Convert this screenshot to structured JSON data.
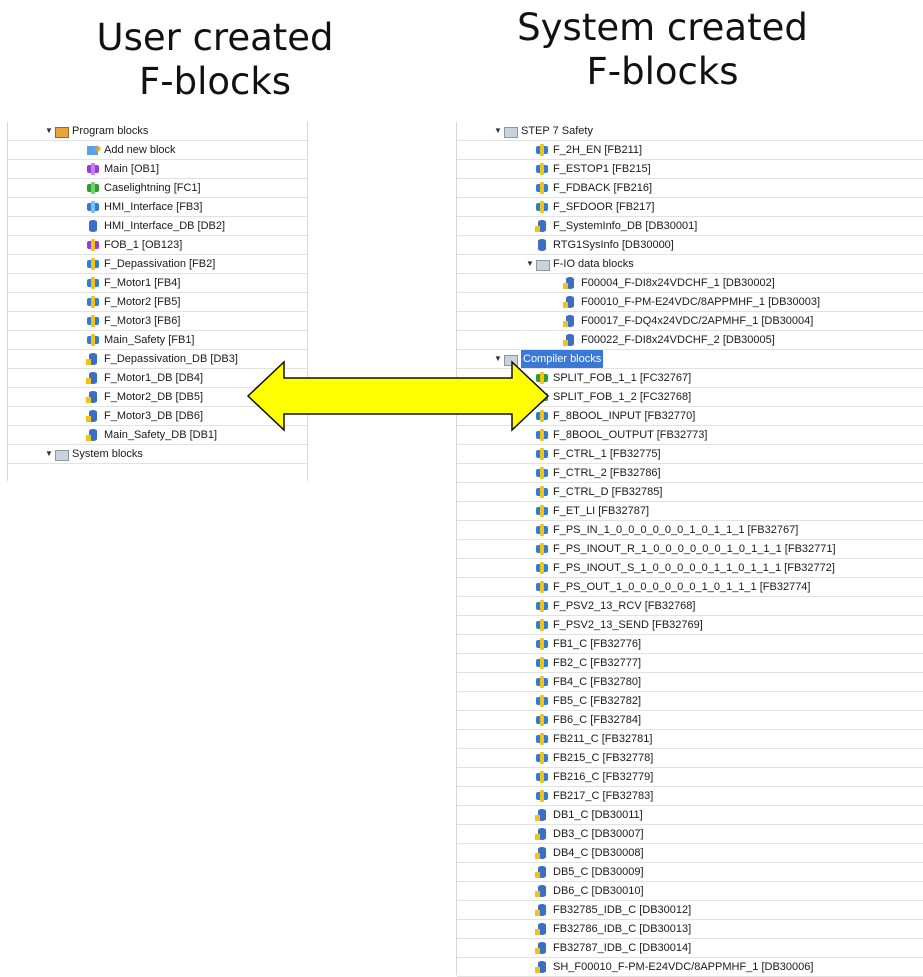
{
  "headings": {
    "left": [
      "User created",
      "F-blocks"
    ],
    "right": [
      "System created",
      "F-blocks"
    ]
  },
  "left_tree": [
    {
      "text": "Program blocks",
      "icon": "folder",
      "indent": 1,
      "toggle": "▼"
    },
    {
      "text": "Add new block",
      "icon": "add",
      "indent": 2
    },
    {
      "text": "Main [OB1]",
      "icon": "ob",
      "indent": 2
    },
    {
      "text": "Caselightning [FC1]",
      "icon": "fc",
      "indent": 2
    },
    {
      "text": "HMI_Interface [FB3]",
      "icon": "fb",
      "indent": 2
    },
    {
      "text": "HMI_Interface_DB [DB2]",
      "icon": "db",
      "indent": 2
    },
    {
      "text": "FOB_1 [OB123]",
      "icon": "fob",
      "indent": 2
    },
    {
      "text": "F_Depassivation [FB2]",
      "icon": "ffb",
      "indent": 2
    },
    {
      "text": "F_Motor1 [FB4]",
      "icon": "ffb",
      "indent": 2
    },
    {
      "text": "F_Motor2 [FB5]",
      "icon": "ffb",
      "indent": 2
    },
    {
      "text": "F_Motor3 [FB6]",
      "icon": "ffb",
      "indent": 2
    },
    {
      "text": "Main_Safety [FB1]",
      "icon": "ffb",
      "indent": 2
    },
    {
      "text": "F_Depassivation_DB [DB3]",
      "icon": "fdb",
      "indent": 2
    },
    {
      "text": "F_Motor1_DB [DB4]",
      "icon": "fdb",
      "indent": 2
    },
    {
      "text": "F_Motor2_DB [DB5]",
      "icon": "fdb",
      "indent": 2
    },
    {
      "text": "F_Motor3_DB [DB6]",
      "icon": "fdb",
      "indent": 2
    },
    {
      "text": "Main_Safety_DB [DB1]",
      "icon": "fdb",
      "indent": 2
    },
    {
      "text": "System blocks",
      "icon": "folder-grey",
      "indent": 1,
      "toggle": "▼"
    }
  ],
  "right_tree": [
    {
      "text": "STEP 7 Safety",
      "icon": "folder-grey",
      "indent": 1,
      "toggle": "▼"
    },
    {
      "text": "F_2H_EN [FB211]",
      "icon": "ffb",
      "indent": 2
    },
    {
      "text": "F_ESTOP1 [FB215]",
      "icon": "ffb",
      "indent": 2
    },
    {
      "text": "F_FDBACK [FB216]",
      "icon": "ffb",
      "indent": 2
    },
    {
      "text": "F_SFDOOR [FB217]",
      "icon": "ffb",
      "indent": 2
    },
    {
      "text": "F_SystemInfo_DB [DB30001]",
      "icon": "fdb",
      "indent": 2
    },
    {
      "text": "RTG1SysInfo [DB30000]",
      "icon": "db",
      "indent": 2
    },
    {
      "text": "F-IO data blocks",
      "icon": "folder-grey",
      "indent": 2,
      "toggle": "▼"
    },
    {
      "text": "F00004_F-DI8x24VDCHF_1 [DB30002]",
      "icon": "fdb",
      "indent": 3
    },
    {
      "text": "F00010_F-PM-E24VDC/8APPMHF_1 [DB30003]",
      "icon": "fdb",
      "indent": 3
    },
    {
      "text": "F00017_F-DQ4x24VDC/2APMHF_1 [DB30004]",
      "icon": "fdb",
      "indent": 3
    },
    {
      "text": "F00022_F-DI8x24VDCHF_2 [DB30005]",
      "icon": "fdb",
      "indent": 3
    },
    {
      "text": "Compiler blocks",
      "icon": "folder-grey",
      "indent": 1,
      "toggle": "▼",
      "selected": true
    },
    {
      "text": "SPLIT_FOB_1_1 [FC32767]",
      "icon": "ffc",
      "indent": 2
    },
    {
      "text": "SPLIT_FOB_1_2 [FC32768]",
      "icon": "ffc",
      "indent": 2
    },
    {
      "text": "F_8BOOL_INPUT [FB32770]",
      "icon": "ffb",
      "indent": 2
    },
    {
      "text": "F_8BOOL_OUTPUT [FB32773]",
      "icon": "ffb",
      "indent": 2
    },
    {
      "text": "F_CTRL_1 [FB32775]",
      "icon": "ffb",
      "indent": 2
    },
    {
      "text": "F_CTRL_2 [FB32786]",
      "icon": "ffb",
      "indent": 2
    },
    {
      "text": "F_CTRL_D [FB32785]",
      "icon": "ffb",
      "indent": 2
    },
    {
      "text": "F_ET_LI [FB32787]",
      "icon": "ffb",
      "indent": 2
    },
    {
      "text": "F_PS_IN_1_0_0_0_0_0_0_1_0_1_1_1 [FB32767]",
      "icon": "ffb",
      "indent": 2
    },
    {
      "text": "F_PS_INOUT_R_1_0_0_0_0_0_0_1_0_1_1_1 [FB32771]",
      "icon": "ffb",
      "indent": 2
    },
    {
      "text": "F_PS_INOUT_S_1_0_0_0_0_0_1_1_0_1_1_1 [FB32772]",
      "icon": "ffb",
      "indent": 2
    },
    {
      "text": "F_PS_OUT_1_0_0_0_0_0_0_1_0_1_1_1 [FB32774]",
      "icon": "ffb",
      "indent": 2
    },
    {
      "text": "F_PSV2_13_RCV [FB32768]",
      "icon": "ffb",
      "indent": 2
    },
    {
      "text": "F_PSV2_13_SEND [FB32769]",
      "icon": "ffb",
      "indent": 2
    },
    {
      "text": "FB1_C [FB32776]",
      "icon": "ffb",
      "indent": 2
    },
    {
      "text": "FB2_C [FB32777]",
      "icon": "ffb",
      "indent": 2
    },
    {
      "text": "FB4_C [FB32780]",
      "icon": "ffb",
      "indent": 2
    },
    {
      "text": "FB5_C [FB32782]",
      "icon": "ffb",
      "indent": 2
    },
    {
      "text": "FB6_C [FB32784]",
      "icon": "ffb",
      "indent": 2
    },
    {
      "text": "FB211_C [FB32781]",
      "icon": "ffb",
      "indent": 2
    },
    {
      "text": "FB215_C [FB32778]",
      "icon": "ffb",
      "indent": 2
    },
    {
      "text": "FB216_C [FB32779]",
      "icon": "ffb",
      "indent": 2
    },
    {
      "text": "FB217_C [FB32783]",
      "icon": "ffb",
      "indent": 2
    },
    {
      "text": "DB1_C [DB30011]",
      "icon": "fdb",
      "indent": 2
    },
    {
      "text": "DB3_C [DB30007]",
      "icon": "fdb",
      "indent": 2
    },
    {
      "text": "DB4_C [DB30008]",
      "icon": "fdb",
      "indent": 2
    },
    {
      "text": "DB5_C [DB30009]",
      "icon": "fdb",
      "indent": 2
    },
    {
      "text": "DB6_C [DB30010]",
      "icon": "fdb",
      "indent": 2
    },
    {
      "text": "FB32785_IDB_C [DB30012]",
      "icon": "fdb",
      "indent": 2
    },
    {
      "text": "FB32786_IDB_C [DB30013]",
      "icon": "fdb",
      "indent": 2
    },
    {
      "text": "FB32787_IDB_C [DB30014]",
      "icon": "fdb",
      "indent": 2
    },
    {
      "text": "SH_F00010_F-PM-E24VDC/8APPMHF_1 [DB30006]",
      "icon": "fdb",
      "indent": 2
    }
  ],
  "colors": {
    "arrow_fill": "#ffff00",
    "arrow_stroke": "#111111",
    "selection": "#3a78d6"
  },
  "icon_names": {
    "folder": "folder-icon",
    "folder-grey": "system-folder-icon",
    "add": "add-block-icon",
    "ob": "organization-block-icon",
    "fc": "function-icon",
    "fb": "function-block-icon",
    "ffb": "safety-function-block-icon",
    "ffc": "safety-function-icon",
    "fob": "safety-organization-block-icon",
    "db": "data-block-icon",
    "fdb": "safety-data-block-icon"
  }
}
